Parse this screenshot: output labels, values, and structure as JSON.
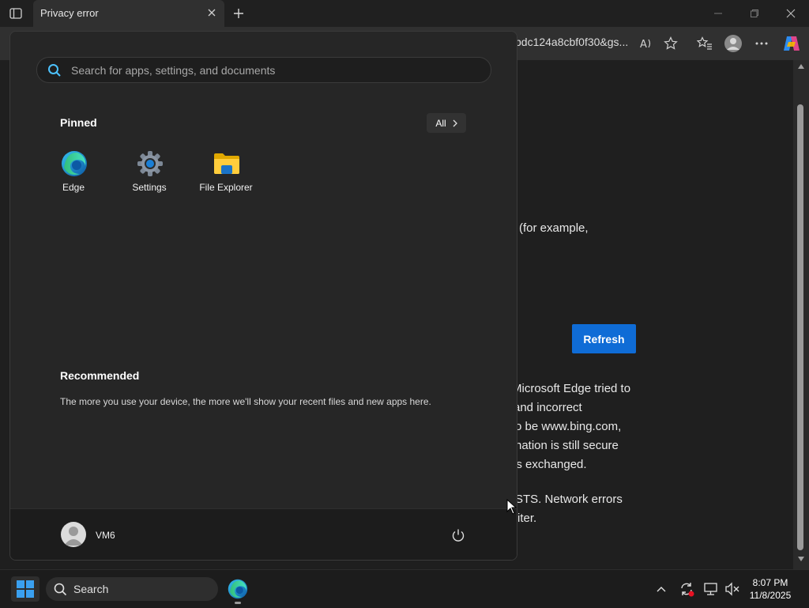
{
  "browser": {
    "tab_title": "Privacy error",
    "url_fragment": "bdc124a8cbf0f30&gs...",
    "page": {
      "line1": "(for example,",
      "refresh_label": "Refresh",
      "para_lines": [
        "Microsoft Edge tried to",
        "and incorrect",
        "o be www.bing.com,",
        "nation is still secure",
        "is exchanged."
      ],
      "hsts_lines": [
        "STS. Network errors",
        "iter."
      ]
    }
  },
  "start_menu": {
    "search_placeholder": "Search for apps, settings, and documents",
    "pinned_heading": "Pinned",
    "all_label": "All",
    "pinned_apps": [
      {
        "label": "Edge",
        "icon": "edge-icon"
      },
      {
        "label": "Settings",
        "icon": "settings-gear-icon"
      },
      {
        "label": "File Explorer",
        "icon": "folder-icon"
      }
    ],
    "recommended_heading": "Recommended",
    "recommended_text": "The more you use your device, the more we'll show your recent files and new apps here.",
    "user_name": "VM6"
  },
  "taskbar": {
    "search_label": "Search",
    "time": "8:07 PM",
    "date": "11/8/2025"
  },
  "colors": {
    "accent": "#0f6cd6",
    "menu_bg": "#262626",
    "taskbar_bg": "#1c1c1c"
  }
}
